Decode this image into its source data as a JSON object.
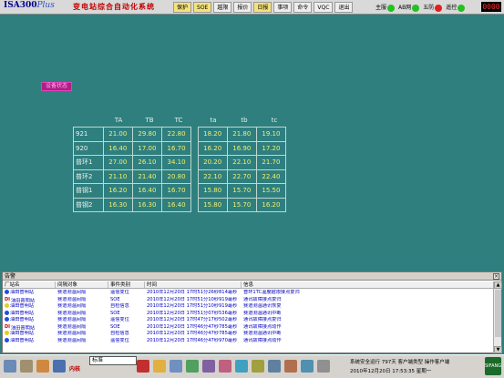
{
  "app": {
    "title": "ISA300",
    "title_suffix": "Plus",
    "subtitle": "变电站综合自动化系统"
  },
  "menu": [
    "保护",
    "SOE",
    "越限",
    "报价",
    "日报",
    "事项",
    "命令",
    "VQC",
    "退出"
  ],
  "status": {
    "items": [
      {
        "label": "主服",
        "color": "#22c022"
      },
      {
        "label": "AB网",
        "color": "#22c022"
      },
      {
        "label": "五防",
        "color": "#e02020"
      },
      {
        "label": "遥控",
        "color": "#22c022"
      }
    ],
    "clock": "0000"
  },
  "widget": {
    "label": "设备状态"
  },
  "table": {
    "columns": [
      "TA",
      "TB",
      "TC",
      "ta",
      "tb",
      "tc"
    ],
    "rows": [
      {
        "name": "921",
        "values": [
          "21.00",
          "29.80",
          "22.80",
          "18.20",
          "21.80",
          "19.10"
        ]
      },
      {
        "name": "920",
        "values": [
          "16.40",
          "17.00",
          "16.70",
          "16.20",
          "16.90",
          "17.20"
        ]
      },
      {
        "name": "普环1",
        "values": [
          "27.00",
          "26.10",
          "34.10",
          "20.20",
          "22.10",
          "21.70"
        ]
      },
      {
        "name": "普环2",
        "values": [
          "21.10",
          "21.40",
          "20.80",
          "22.10",
          "22.70",
          "22.40"
        ]
      },
      {
        "name": "普钢1",
        "values": [
          "16.20",
          "16.40",
          "16.70",
          "15.80",
          "15.70",
          "15.50"
        ]
      },
      {
        "name": "普钢2",
        "values": [
          "16.30",
          "16.30",
          "16.40",
          "15.80",
          "15.70",
          "16.20"
        ]
      }
    ]
  },
  "alarm": {
    "title": "告警",
    "headers": [
      "厂站名",
      "间隔对象",
      "事件类别",
      "时间",
      "信息"
    ],
    "rows": [
      {
        "icon": "dot",
        "site": "油田普明站",
        "obj": "赛道测温间隔",
        "type": "遥信变位",
        "time": "2010年12月20日 17时51分26秒814毫秒",
        "info": "普环1TC温度越限接点复归"
      },
      {
        "icon": "di",
        "site": "油田普明站",
        "obj": "赛道测温间隔",
        "type": "SOE",
        "time": "2010年12月20日 17时51分10秒919毫秒",
        "info": "通讯故障接点复归"
      },
      {
        "icon": "y",
        "site": "油田普明站",
        "obj": "赛道测温间隔",
        "type": "自检信息",
        "time": "2010年12月20日 17时51分10秒919毫秒",
        "info": "赛道测温通讯恢复"
      },
      {
        "icon": "dot",
        "site": "油田普明站",
        "obj": "赛道测温间隔",
        "type": "SOE",
        "time": "2010年12月20日 17时51分07秒536毫秒",
        "info": "赛道测温通讯中断"
      },
      {
        "icon": "dot",
        "site": "油田普明站",
        "obj": "赛道测温间隔",
        "type": "遥信变位",
        "time": "2010年12月20日 17时47分17秒502毫秒",
        "info": "通讯故障接点复归"
      },
      {
        "icon": "di",
        "site": "油田普明站",
        "obj": "赛道测温间隔",
        "type": "SOE",
        "time": "2010年12月20日 17时46分47秒785毫秒",
        "info": "通讯故障接点动作"
      },
      {
        "icon": "y",
        "site": "油田普明站",
        "obj": "赛道测温间隔",
        "type": "自检信息",
        "time": "2010年12月20日 17时46分47秒785毫秒",
        "info": "赛道测温通讯中断"
      },
      {
        "icon": "dot",
        "site": "油田普明站",
        "obj": "赛道测温间隔",
        "type": "遥信变位",
        "time": "2010年12月20日 17时46分47秒970毫秒",
        "info": "通讯故障接点动作"
      }
    ]
  },
  "taskbar": {
    "red_label": "内核",
    "search_value": "标准",
    "status_line1": [
      "系统安全运行",
      "797天",
      "客户端类型",
      "操作客户端"
    ],
    "status_line2": [
      "2010年12月20日",
      "17:53:35",
      "星期一"
    ],
    "logo": "SIFANG"
  }
}
